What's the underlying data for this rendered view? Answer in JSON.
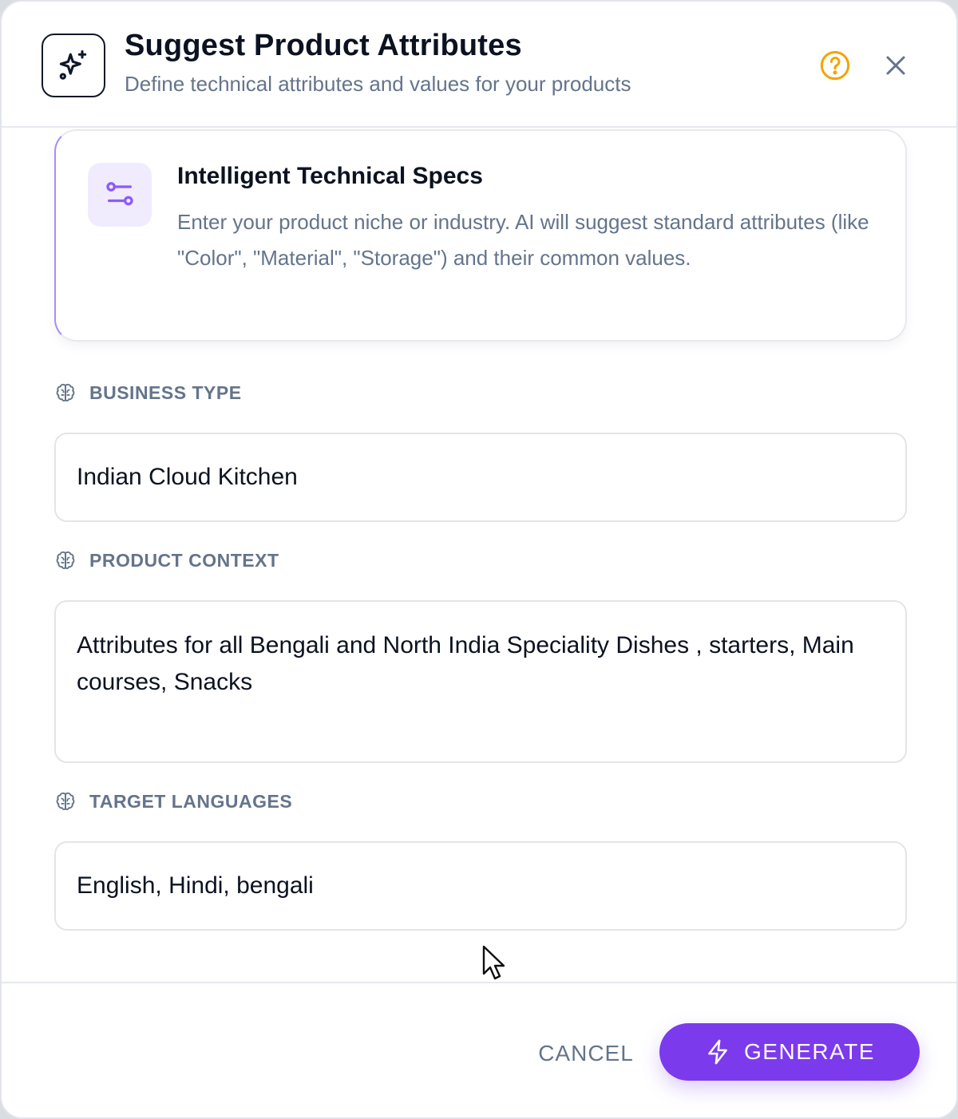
{
  "dialog": {
    "title": "Suggest Product Attributes",
    "subtitle": "Define technical attributes and values for your products",
    "header_icon": "sparkles-icon",
    "help_icon": "help-circle-icon",
    "close_icon": "close-icon"
  },
  "info_card": {
    "icon": "sliders-icon",
    "title": "Intelligent Technical Specs",
    "text": "Enter your product niche or industry. AI will suggest standard attributes (like \"Color\", \"Material\", \"Storage\") and their common values."
  },
  "fields": {
    "business_type": {
      "label": "BUSINESS TYPE",
      "icon": "brain-icon",
      "value": "Indian Cloud Kitchen"
    },
    "product_context": {
      "label": "PRODUCT CONTEXT",
      "icon": "brain-icon",
      "value": "Attributes for all Bengali and North India Speciality Dishes , starters, Main courses, Snacks"
    },
    "target_languages": {
      "label": "TARGET LANGUAGES",
      "icon": "brain-icon",
      "value": "English, Hindi, bengali"
    }
  },
  "footer": {
    "cancel_label": "CANCEL",
    "generate_label": "GENERATE",
    "generate_icon": "lightning-icon"
  },
  "colors": {
    "accent": "#7c3aed",
    "accent_soft": "#f1ebfe",
    "help": "#f5a300",
    "muted_text": "#64748b",
    "border": "#e2e5ea"
  }
}
